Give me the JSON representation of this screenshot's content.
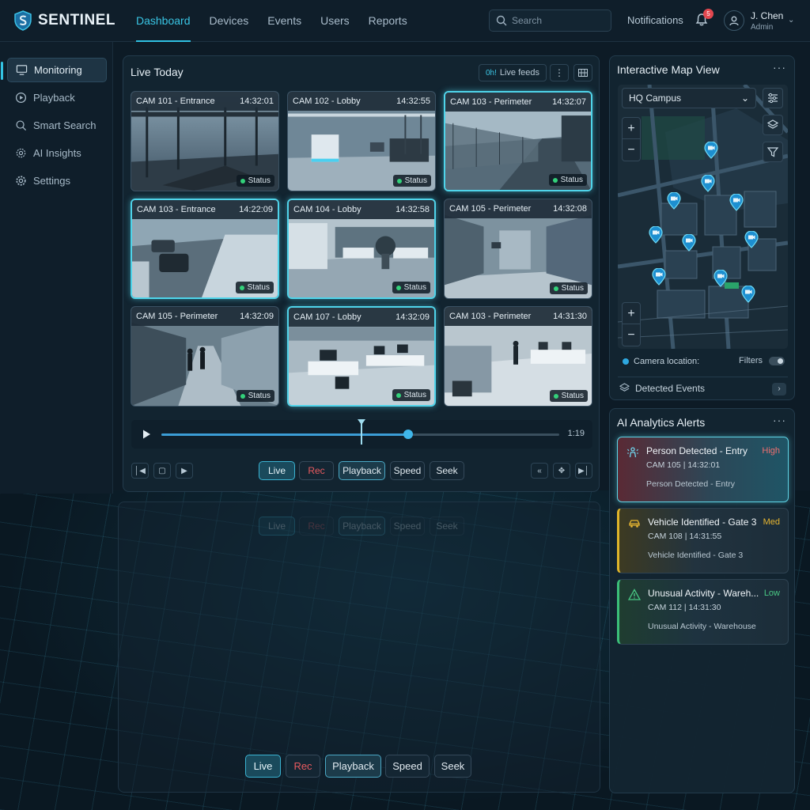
{
  "app": {
    "name": "SENTINEL"
  },
  "nav": {
    "items": [
      {
        "label": "Dashboard",
        "active": true
      },
      {
        "label": "Devices"
      },
      {
        "label": "Events"
      },
      {
        "label": "Users"
      },
      {
        "label": "Reports"
      }
    ]
  },
  "search": {
    "placeholder": "Search"
  },
  "notifications": {
    "label": "Notifications",
    "count": "5"
  },
  "user": {
    "name": "J. Chen",
    "role": "Admin"
  },
  "sidebar": {
    "items": [
      {
        "label": "Monitoring",
        "icon": "monitor-icon",
        "active": true
      },
      {
        "label": "Playback",
        "icon": "play-circle-icon"
      },
      {
        "label": "Smart Search",
        "icon": "search-icon"
      },
      {
        "label": "AI Insights",
        "icon": "ai-chip-icon"
      },
      {
        "label": "Settings",
        "icon": "gear-icon"
      }
    ]
  },
  "live": {
    "title": "Live Today",
    "feeds_label": "Live feeds",
    "feeds_icon_text": "0h!",
    "cameras": [
      {
        "name": "CAM 101 - Entrance",
        "time": "14:32:01",
        "status": "Status",
        "highlight": false
      },
      {
        "name": "CAM 102 - Lobby",
        "time": "14:32:55",
        "status": "Status",
        "highlight": false
      },
      {
        "name": "CAM 103 - Perimeter",
        "time": "14:32:07",
        "status": "Status",
        "highlight": true
      },
      {
        "name": "CAM 103 - Entrance",
        "time": "14:22:09",
        "status": "Status",
        "highlight": true
      },
      {
        "name": "CAM 104 - Lobby",
        "time": "14:32:58",
        "status": "Status",
        "highlight": true
      },
      {
        "name": "CAM 105 - Perimeter",
        "time": "14:32:08",
        "status": "Status",
        "highlight": false
      },
      {
        "name": "CAM 105 - Perimeter",
        "time": "14:32:09",
        "status": "Status",
        "highlight": false
      },
      {
        "name": "CAM 107 - Lobby",
        "time": "14:32:09",
        "status": "Status",
        "highlight": true
      },
      {
        "name": "CAM 103 - Perimeter",
        "time": "14:31:30",
        "status": "Status",
        "highlight": false
      }
    ],
    "timeline": {
      "time": "1:19",
      "progress": 0.62,
      "marker": 0.5
    },
    "modes": {
      "live": "Live",
      "rec": "Rec",
      "playback": "Playback",
      "speed": "Speed",
      "seek": "Seek"
    }
  },
  "map": {
    "title": "Interactive Map View",
    "location": "HQ Campus",
    "legend_label": "Camera location:",
    "filters_label": "Filters",
    "detected_events": "Detected Events"
  },
  "alerts": {
    "title": "AI Analytics Alerts",
    "items": [
      {
        "title": "Person Detected - Entry",
        "severity": "High",
        "camera": "CAM 105",
        "time": "14:32:01",
        "desc": "Person Detected - Entry",
        "icon": "person-alert-icon",
        "sev_color": "#ef6f6f"
      },
      {
        "title": "Vehicle Identified - Gate 3",
        "severity": "Med",
        "camera": "CAM 108",
        "time": "14:31:55",
        "desc": "Vehicle Identified - Gate 3",
        "icon": "car-icon",
        "sev_color": "#e8b630"
      },
      {
        "title": "Unusual Activity - Wareh...",
        "severity": "Low",
        "camera": "CAM 112",
        "time": "14:31:30",
        "desc": "Unusual Activity - Warehouse",
        "icon": "warning-icon",
        "sev_color": "#49c884"
      }
    ]
  },
  "colors": {
    "accent": "#2fc0e2",
    "background": "#0d1b26",
    "status_green": "#33d17a",
    "rec_red": "#e85a5f"
  }
}
